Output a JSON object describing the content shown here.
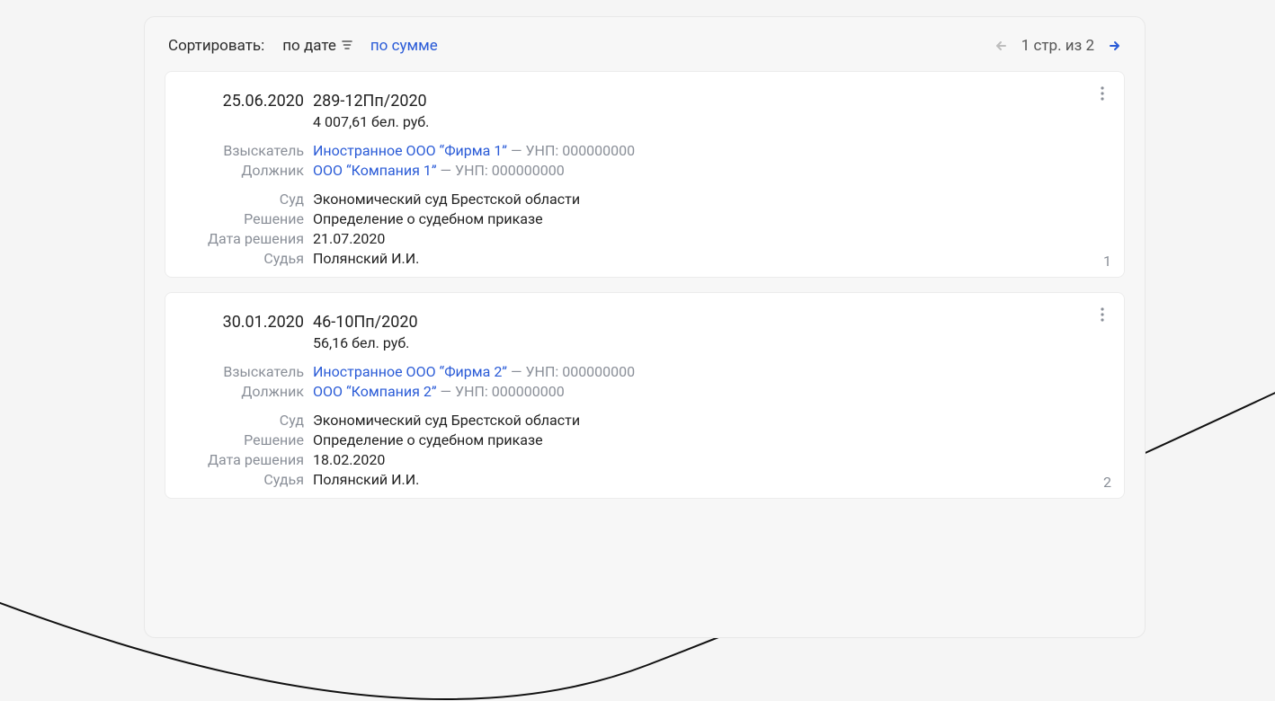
{
  "sort": {
    "label": "Сортировать:",
    "active_by_date": "по дате",
    "by_amount": "по сумме"
  },
  "pager": {
    "text": "1 стр. из 2"
  },
  "labels": {
    "creditor": "Взыскатель",
    "debtor": "Должник",
    "court": "Суд",
    "decision": "Решение",
    "decision_date": "Дата решения",
    "judge": "Судья",
    "unp_prefix": "— УНП:"
  },
  "cards": [
    {
      "index": "1",
      "date": "25.06.2020",
      "case_no": "289-12Пп/2020",
      "amount": "4 007,61 бел. руб.",
      "creditor_name": "Иностранное ООО “Фирма 1”",
      "creditor_unp": "000000000",
      "debtor_name": "ООО “Компания 1”",
      "debtor_unp": "000000000",
      "court": "Экономический суд Брестской области",
      "decision": "Определение о судебном приказе",
      "decision_date": "21.07.2020",
      "judge": "Полянский И.И."
    },
    {
      "index": "2",
      "date": "30.01.2020",
      "case_no": "46-10Пп/2020",
      "amount": "56,16 бел. руб.",
      "creditor_name": "Иностранное ООО “Фирма 2”",
      "creditor_unp": "000000000",
      "debtor_name": "ООО “Компания 2”",
      "debtor_unp": "000000000",
      "court": "Экономический суд Брестской области",
      "decision": "Определение о судебном приказе",
      "decision_date": "18.02.2020",
      "judge": "Полянский И.И."
    }
  ]
}
